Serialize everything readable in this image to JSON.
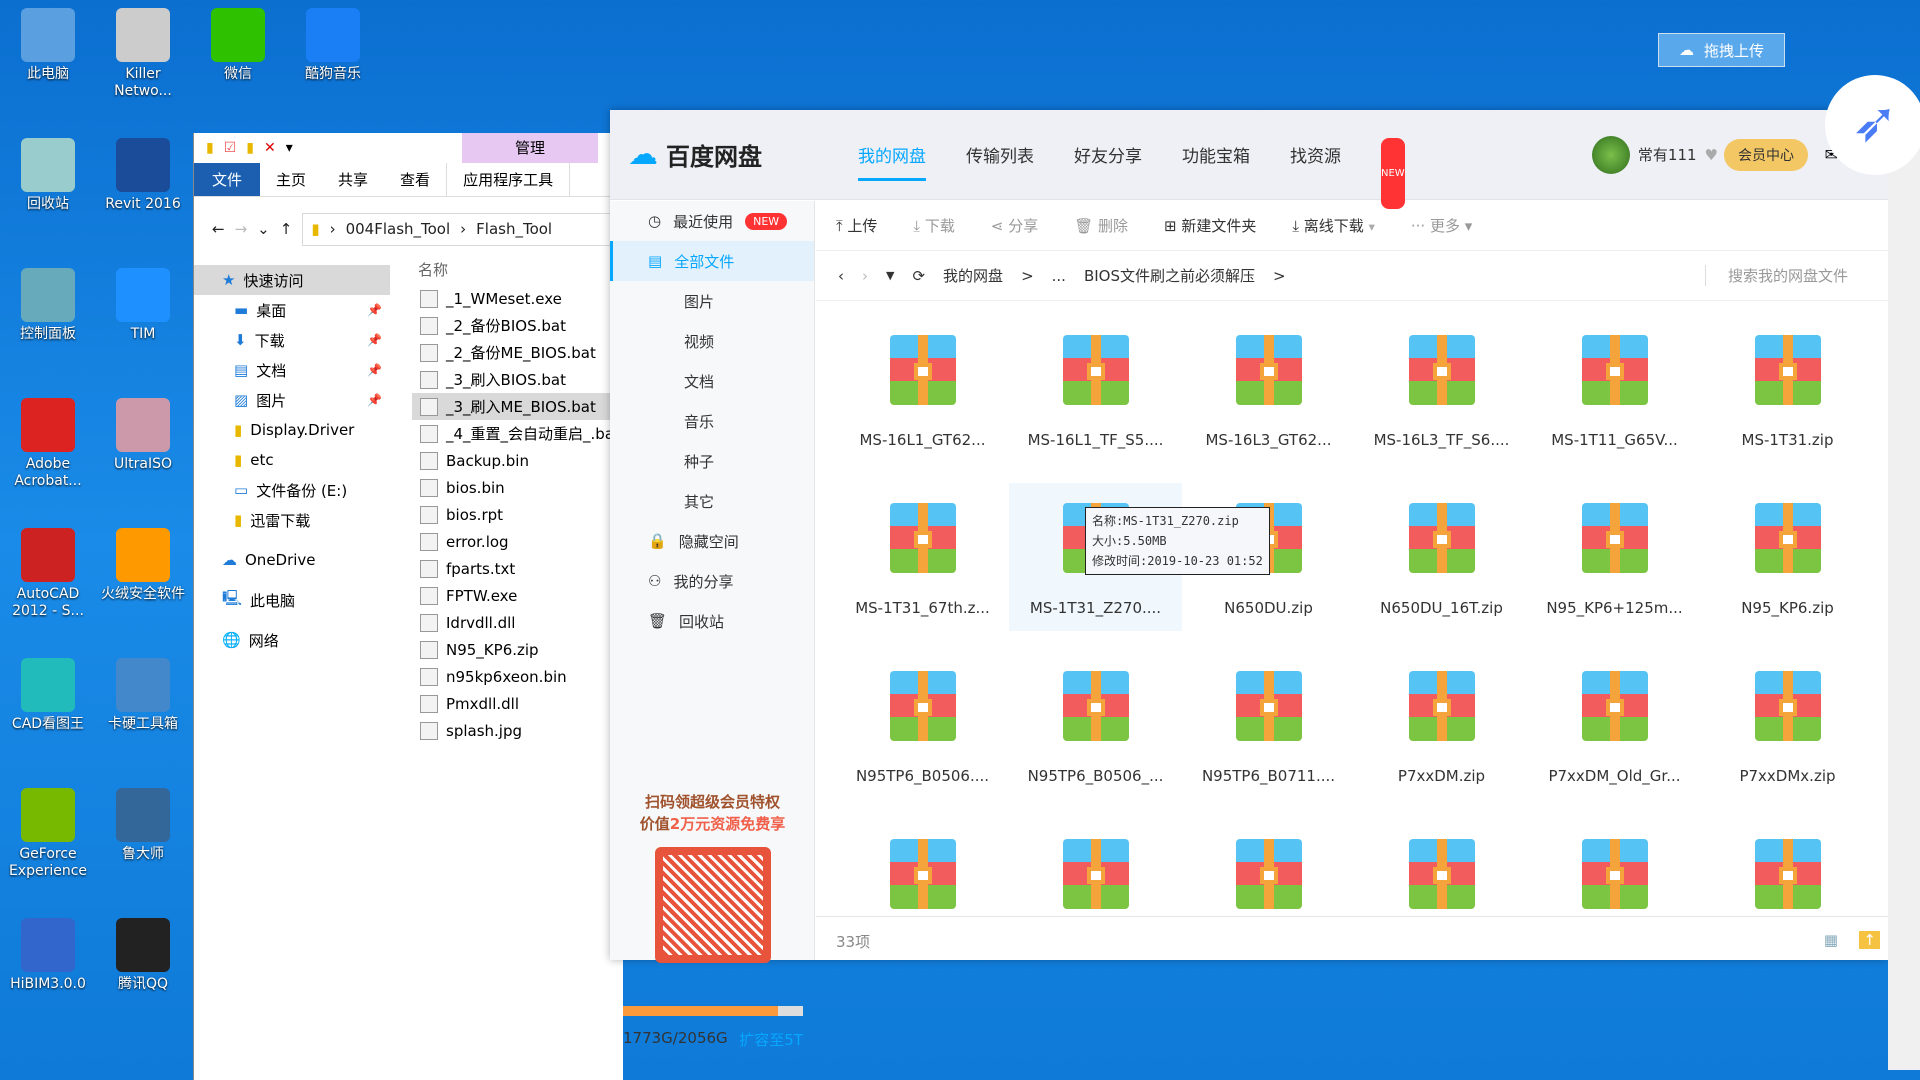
{
  "desktop": {
    "icons": [
      {
        "label": "此电脑",
        "color": "#5aa0e0"
      },
      {
        "label": "Killer Netwo...",
        "color": "#ccc"
      },
      {
        "label": "微信",
        "color": "#2dc100"
      },
      {
        "label": "酷狗音乐",
        "color": "#1a7ef5"
      },
      {
        "label": "回收站",
        "color": "#9cc"
      },
      {
        "label": "Revit 2016",
        "color": "#1b4c9a"
      },
      {
        "label": "控制面板",
        "color": "#6ab"
      },
      {
        "label": "TIM",
        "color": "#1e90ff"
      },
      {
        "label": "Adobe Acrobat...",
        "color": "#d22"
      },
      {
        "label": "UltraISO",
        "color": "#c9a"
      },
      {
        "label": "AutoCAD 2012 - S...",
        "color": "#c22"
      },
      {
        "label": "火绒安全软件",
        "color": "#f90"
      },
      {
        "label": "CAD看图王",
        "color": "#2bb"
      },
      {
        "label": "卡硬工具箱",
        "color": "#48c"
      },
      {
        "label": "GeForce Experience",
        "color": "#76b900"
      },
      {
        "label": "鲁大师",
        "color": "#369"
      },
      {
        "label": "HiBIM3.0.0",
        "color": "#36c"
      },
      {
        "label": "腾讯QQ",
        "color": "#222"
      }
    ]
  },
  "explorer": {
    "ribbon": {
      "file": "文件",
      "home": "主页",
      "share": "共享",
      "view": "查看",
      "manage": "管理",
      "app_tools": "应用程序工具"
    },
    "address": [
      "004Flash_Tool",
      "Flash_Tool"
    ],
    "nav": [
      {
        "label": "快速访问",
        "pin": false
      },
      {
        "label": "桌面",
        "pin": true
      },
      {
        "label": "下载",
        "pin": true
      },
      {
        "label": "文档",
        "pin": true
      },
      {
        "label": "图片",
        "pin": true
      },
      {
        "label": "Display.Driver"
      },
      {
        "label": "etc"
      },
      {
        "label": "文件备份 (E:)"
      },
      {
        "label": "迅雷下载"
      },
      {
        "label": "OneDrive"
      },
      {
        "label": "此电脑"
      },
      {
        "label": "网络"
      }
    ],
    "column_header": "名称",
    "files": [
      "_1_WMeset.exe",
      "_2_备份BIOS.bat",
      "_2_备份ME_BIOS.bat",
      "_3_刷入BIOS.bat",
      "_3_刷入ME_BIOS.bat",
      "_4_重置_会自动重启_.bat",
      "Backup.bin",
      "bios.bin",
      "bios.rpt",
      "error.log",
      "fparts.txt",
      "FPTW.exe",
      "Idrvdll.dll",
      "N95_KP6.zip",
      "n95kp6xeon.bin",
      "Pmxdll.dll",
      "splash.jpg"
    ],
    "selected_file": "_3_刷入ME_BIOS.bat"
  },
  "baidu": {
    "app_name": "百度网盘",
    "tabs": [
      "我的网盘",
      "传输列表",
      "好友分享",
      "功能宝箱",
      "找资源"
    ],
    "active_tab": "我的网盘",
    "new_badge": "NEW",
    "username": "常有111",
    "vip_center": "会员中心",
    "sidebar": [
      {
        "label": "最近使用",
        "badge": "NEW"
      },
      {
        "label": "全部文件",
        "active": true
      },
      {
        "label": "图片",
        "sub": true
      },
      {
        "label": "视频",
        "sub": true
      },
      {
        "label": "文档",
        "sub": true
      },
      {
        "label": "音乐",
        "sub": true
      },
      {
        "label": "种子",
        "sub": true
      },
      {
        "label": "其它",
        "sub": true
      },
      {
        "label": "隐藏空间"
      },
      {
        "label": "我的分享"
      },
      {
        "label": "回收站"
      }
    ],
    "promo": {
      "line1": "扫码领超级会员特权",
      "line2_prefix": "价值",
      "line2_highlight": "2万元资源免费享"
    },
    "storage": {
      "used": "1773G/2056G",
      "fraction": 0.862,
      "expand": "扩容至5T"
    },
    "toolbar": {
      "upload": "上传",
      "download": "下载",
      "share": "分享",
      "delete": "删除",
      "new_folder": "新建文件夹",
      "offline": "离线下载",
      "more": "更多"
    },
    "breadcrumb": {
      "root": "我的网盘",
      "ellipsis": "...",
      "current": "BIOS文件刷之前必须解压"
    },
    "search_placeholder": "搜索我的网盘文件",
    "files": [
      "MS-16L1_GT62...",
      "MS-16L1_TF_S5....",
      "MS-16L3_GT62...",
      "MS-16L3_TF_S6....",
      "MS-1T11_G65V...",
      "MS-1T31.zip",
      "MS-1T31_67th.z...",
      "MS-1T31_Z270....",
      "N650DU.zip",
      "N650DU_16T.zip",
      "N95_KP6+125m...",
      "N95_KP6.zip",
      "N95TP6_B0506....",
      "N95TP6_B0506_...",
      "N95TP6_B0711....",
      "P7xxDM.zip",
      "P7xxDM_Old_Gr...",
      "P7xxDMx.zip",
      "",
      "",
      "",
      "",
      "",
      ""
    ],
    "tooltip": {
      "name": "名称:MS-1T31_Z270.zip",
      "size": "大小:5.50MB",
      "mtime": "修改时间:2019-10-23 01:52"
    },
    "item_count": "33项",
    "drag_upload": "拖拽上传"
  }
}
